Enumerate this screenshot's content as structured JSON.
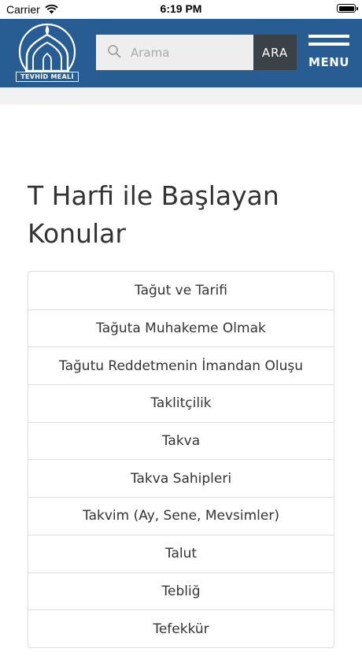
{
  "status_bar": {
    "carrier": "Carrier",
    "time": "6:19 PM"
  },
  "header": {
    "logo_text": "TEVHİD MEALİ",
    "search": {
      "placeholder": "Arama",
      "value": ""
    },
    "search_button_label": "ARA",
    "menu_label": "MENU"
  },
  "main": {
    "title": "T Harfi ile Başlayan Konular",
    "topics": [
      "Tağut ve Tarifi",
      "Tağuta Muhakeme Olmak",
      "Tağutu Reddetmenin İmandan Oluşu",
      "Taklitçilik",
      "Takva",
      "Takva Sahipleri",
      "Takvim (Ay, Sene, Mevsimler)",
      "Talut",
      "Tebliğ",
      "Tefekkür"
    ]
  },
  "colors": {
    "header_bg": "#275d93",
    "search_button_bg": "#3a4147",
    "search_box_bg": "#eeeeee",
    "page_bg": "#f2f2f2",
    "card_bg": "#ffffff",
    "text": "#333333",
    "border": "#dddddd"
  },
  "icons": {
    "wifi": "wifi-icon",
    "battery": "battery-icon",
    "search": "search-icon",
    "menu": "hamburger-icon",
    "logo": "mosque-dome-logo"
  }
}
